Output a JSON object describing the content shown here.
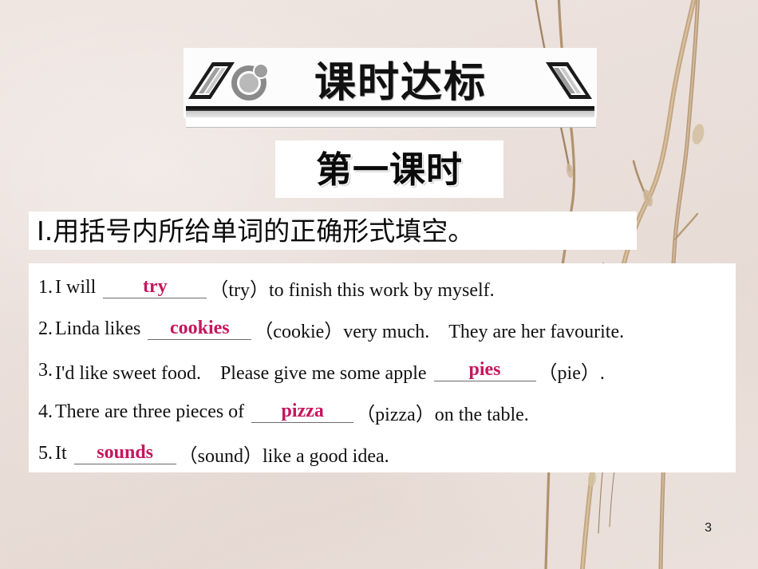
{
  "slide": {
    "page_number": "3",
    "background_color": "#f2e9e5",
    "panel_color": "#ffffff",
    "answer_color": "#c7155e",
    "text_color": "#111111"
  },
  "banner": {
    "title": "课时达标",
    "icon": "bubbles-logo-icon",
    "left_decoration": "chevron-stripes-icon",
    "right_decoration": "chevron-stripes-icon"
  },
  "lesson_box": {
    "label": "第一课时"
  },
  "section": {
    "heading": "Ⅰ.用括号内所给单词的正确形式填空。"
  },
  "exercises": [
    {
      "number": "1.",
      "before": "I will",
      "answer": "try",
      "blank_width": 130,
      "after": "（try）to finish this work by myself."
    },
    {
      "number": "2.",
      "before": "Linda likes",
      "answer": "cookies",
      "blank_width": 130,
      "after": "（cookie）very much.　They are her favourite."
    },
    {
      "number": "3.",
      "before": "I'd like sweet food.　Please give me some apple",
      "answer": "pies",
      "blank_width": 128,
      "after": "（pie）."
    },
    {
      "number": "4.",
      "before": "There are three pieces of",
      "answer": "pizza",
      "blank_width": 128,
      "after": "（pizza）on the table."
    },
    {
      "number": "5.",
      "before": "It",
      "answer": "sounds",
      "blank_width": 128,
      "after": "（sound）like a good idea."
    }
  ]
}
